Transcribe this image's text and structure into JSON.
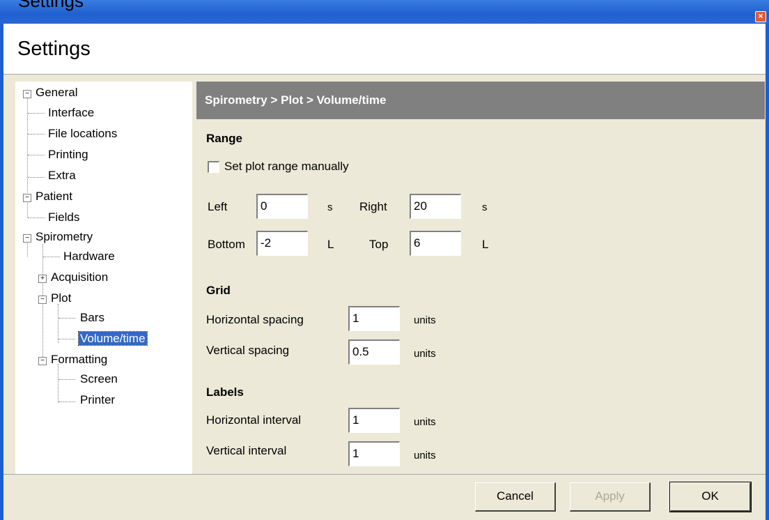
{
  "window": {
    "caption_fragment": "Settings",
    "header_title": "Settings",
    "close_glyph": "×"
  },
  "tree": {
    "items": [
      {
        "label": "General",
        "level": 0,
        "expanded": true
      },
      {
        "label": "Interface",
        "level": 1
      },
      {
        "label": "File locations",
        "level": 1
      },
      {
        "label": "Printing",
        "level": 1
      },
      {
        "label": "Extra",
        "level": 1
      },
      {
        "label": "Patient",
        "level": 0,
        "expanded": true
      },
      {
        "label": "Fields",
        "level": 1
      },
      {
        "label": "Spirometry",
        "level": 0,
        "expanded": true
      },
      {
        "label": "Hardware",
        "level": 1
      },
      {
        "label": "Acquisition",
        "level": 1,
        "expanded": false
      },
      {
        "label": "Plot",
        "level": 1,
        "expanded": true
      },
      {
        "label": "Bars",
        "level": 2
      },
      {
        "label": "Volume/time",
        "level": 2,
        "selected": true
      },
      {
        "label": "Formatting",
        "level": 1,
        "expanded": true
      },
      {
        "label": "Screen",
        "level": 2
      },
      {
        "label": "Printer",
        "level": 2
      }
    ]
  },
  "panel": {
    "breadcrumb": "Spirometry > Plot > Volume/time",
    "range": {
      "heading": "Range",
      "manual_checkbox_label": "Set plot range manually",
      "manual_checked": false,
      "left_label": "Left",
      "left_value": "0",
      "left_unit": "s",
      "right_label": "Right",
      "right_value": "20",
      "right_unit": "s",
      "bottom_label": "Bottom",
      "bottom_value": "-2",
      "bottom_unit": "L",
      "top_label": "Top",
      "top_value": "6",
      "top_unit": "L"
    },
    "grid": {
      "heading": "Grid",
      "h_label": "Horizontal spacing",
      "h_value": "1",
      "h_unit": "units",
      "v_label": "Vertical spacing",
      "v_value": "0.5",
      "v_unit": "units"
    },
    "labels": {
      "heading": "Labels",
      "h_label": "Horizontal interval",
      "h_value": "1",
      "h_unit": "units",
      "v_label": "Vertical interval",
      "v_value": "1",
      "v_unit": "units"
    }
  },
  "buttons": {
    "cancel": "Cancel",
    "apply": "Apply",
    "ok": "OK"
  }
}
